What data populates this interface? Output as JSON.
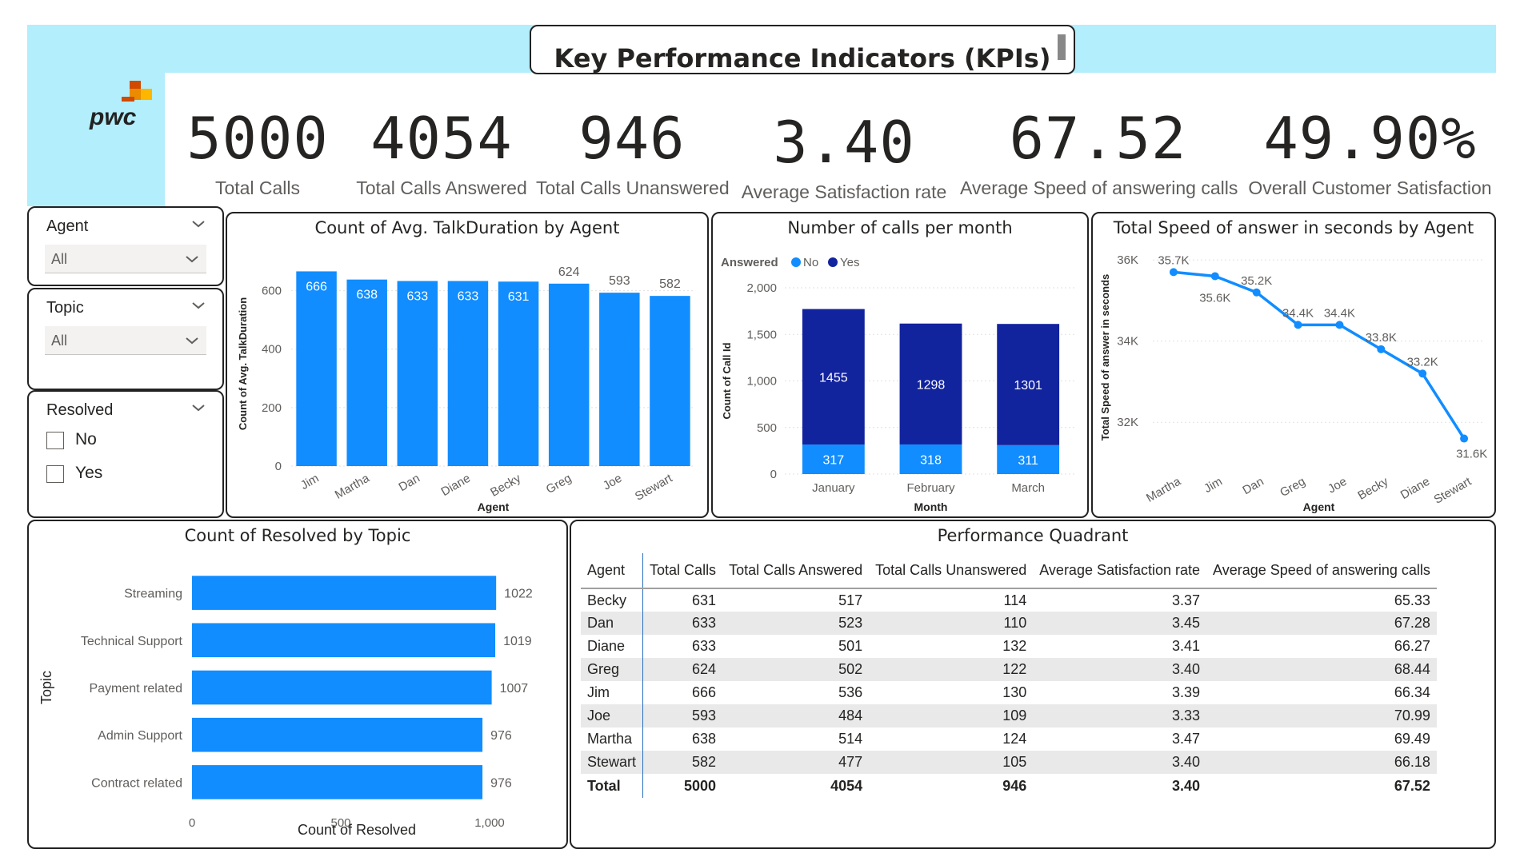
{
  "title": "Key Performance Indicators (KPIs)",
  "logo": {
    "text": "pwc",
    "colors": [
      "#d04a02",
      "#eb8c00",
      "#ffb600",
      "#db536a"
    ]
  },
  "colors": {
    "banner": "#b3eefc",
    "bar": "#118dff",
    "dark_bar": "#12239e"
  },
  "kpis": [
    {
      "value": "5000",
      "label": "Total Calls"
    },
    {
      "value": "4054",
      "label": "Total Calls Answered"
    },
    {
      "value": "946",
      "label": "Total Calls Unanswered"
    },
    {
      "value": "3.40",
      "label": "Average Satisfaction rate"
    },
    {
      "value": "67.52",
      "label": "Average Speed of answering calls"
    },
    {
      "value": "49.90%",
      "label": "Overall Customer Satisfaction"
    }
  ],
  "slicers": {
    "agent": {
      "label": "Agent",
      "value": "All",
      "icon": "chevron-down-icon"
    },
    "topic": {
      "label": "Topic",
      "value": "All",
      "icon": "chevron-down-icon"
    },
    "resolved": {
      "label": "Resolved",
      "options": [
        "No",
        "Yes"
      ],
      "icon": "chevron-down-icon"
    }
  },
  "chart_data": [
    {
      "id": "talk",
      "type": "bar",
      "title": "Count of Avg. TalkDuration by Agent",
      "xlabel": "Agent",
      "ylabel": "Count of Avg. TalkDuration",
      "categories": [
        "Jim",
        "Martha",
        "Dan",
        "Diane",
        "Becky",
        "Greg",
        "Joe",
        "Stewart"
      ],
      "values": [
        666,
        638,
        633,
        633,
        631,
        624,
        593,
        582
      ],
      "yticks": [
        "0",
        "200",
        "400",
        "600"
      ],
      "ylim": [
        0,
        700
      ],
      "color": "#118dff",
      "grid": true
    },
    {
      "id": "month",
      "type": "bar",
      "stacked": true,
      "title": "Number of calls per month",
      "xlabel": "Month",
      "ylabel": "Count of Call Id",
      "legend_title": "Answered",
      "categories": [
        "January",
        "February",
        "March"
      ],
      "series": [
        {
          "name": "No",
          "values": [
            317,
            318,
            311
          ],
          "color": "#118dff"
        },
        {
          "name": "Yes",
          "values": [
            1455,
            1298,
            1301
          ],
          "color": "#12239e"
        }
      ],
      "yticks": [
        "0",
        "500",
        "1,000",
        "1,500",
        "2,000"
      ],
      "ylim": [
        0,
        2000
      ],
      "grid": true
    },
    {
      "id": "speed",
      "type": "line",
      "title": "Total Speed of answer in seconds by Agent",
      "xlabel": "Agent",
      "ylabel": "Total Speed of answer in seconds",
      "categories": [
        "Martha",
        "Jim",
        "Dan",
        "Greg",
        "Joe",
        "Becky",
        "Diane",
        "Stewart"
      ],
      "values": [
        35700,
        35600,
        35200,
        34400,
        34400,
        33800,
        33200,
        31600
      ],
      "labels": [
        "35.7K",
        "35.6K",
        "35.2K",
        "34.4K",
        "34.4K",
        "33.8K",
        "33.2K",
        "31.6K"
      ],
      "yticks": [
        "32K",
        "34K",
        "36K"
      ],
      "ylim": [
        31000,
        36200
      ],
      "color": "#118dff",
      "grid": true
    },
    {
      "id": "topic",
      "type": "bar",
      "orientation": "horizontal",
      "title": "Count of Resolved by Topic",
      "xlabel": "Count of Resolved",
      "ylabel": "Topic",
      "categories": [
        "Streaming",
        "Technical Support",
        "Payment related",
        "Admin Support",
        "Contract related"
      ],
      "values": [
        1022,
        1019,
        1007,
        976,
        976
      ],
      "xticks": [
        "0",
        "500",
        "1,000"
      ],
      "xlim": [
        0,
        1000
      ],
      "color": "#118dff",
      "grid": false
    }
  ],
  "table": {
    "title": "Performance Quadrant",
    "columns": [
      "Agent",
      "Total Calls",
      "Total Calls Answered",
      "Total Calls Unanswered",
      "Average Satisfaction rate",
      "Average Speed of answering calls"
    ],
    "rows": [
      [
        "Becky",
        "631",
        "517",
        "114",
        "3.37",
        "65.33"
      ],
      [
        "Dan",
        "633",
        "523",
        "110",
        "3.45",
        "67.28"
      ],
      [
        "Diane",
        "633",
        "501",
        "132",
        "3.41",
        "66.27"
      ],
      [
        "Greg",
        "624",
        "502",
        "122",
        "3.40",
        "68.44"
      ],
      [
        "Jim",
        "666",
        "536",
        "130",
        "3.39",
        "66.34"
      ],
      [
        "Joe",
        "593",
        "484",
        "109",
        "3.33",
        "70.99"
      ],
      [
        "Martha",
        "638",
        "514",
        "124",
        "3.47",
        "69.49"
      ],
      [
        "Stewart",
        "582",
        "477",
        "105",
        "3.40",
        "66.18"
      ]
    ],
    "total": [
      "Total",
      "5000",
      "4054",
      "946",
      "3.40",
      "67.52"
    ]
  }
}
